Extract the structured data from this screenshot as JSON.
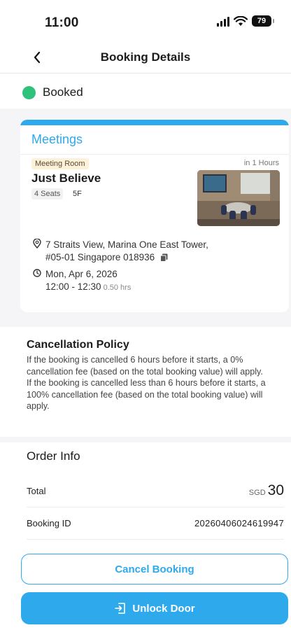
{
  "status_bar": {
    "time": "11:00",
    "battery": "79"
  },
  "nav": {
    "title": "Booking Details"
  },
  "booking_status": {
    "label": "Booked",
    "color": "#2fc27c"
  },
  "card": {
    "category": "Meetings",
    "room_type": "Meeting Room",
    "eta": "in 1 Hours",
    "room_name": "Just Believe",
    "seats": "4 Seats",
    "floor": "5F",
    "address_line1": "7 Straits View, Marina One East Tower,",
    "address_line2": "#05-01 Singapore 018936",
    "date": "Mon, Apr 6, 2026",
    "time_range": "12:00 - 12:30",
    "duration": "0.50 hrs"
  },
  "policy": {
    "title": "Cancellation Policy",
    "line1": "If the booking is cancelled 6 hours before it starts, a 0% cancellation fee (based on the total booking value) will apply.",
    "line2": "If the booking is cancelled less than 6 hours before it starts, a 100% cancellation fee (based on the total booking value) will apply."
  },
  "order": {
    "title": "Order Info",
    "total_label": "Total",
    "currency": "SGD",
    "total_amount": "30",
    "booking_id_label": "Booking ID",
    "booking_id": "20260406024619947"
  },
  "actions": {
    "cancel_label": "Cancel Booking",
    "unlock_label": "Unlock Door"
  },
  "colors": {
    "accent": "#2ea9ec",
    "status_green": "#2fc27c"
  }
}
